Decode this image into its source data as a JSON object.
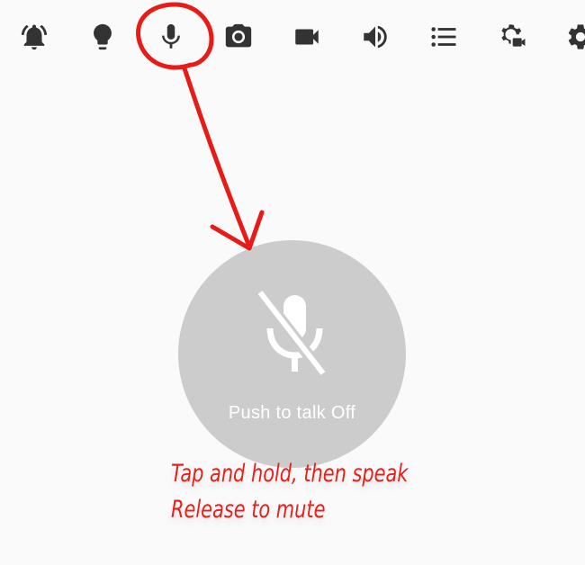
{
  "toolbar": {
    "items": [
      {
        "icon": "alarm-bell-icon",
        "label": "Alarm"
      },
      {
        "icon": "lightbulb-icon",
        "label": "Light"
      },
      {
        "icon": "microphone-icon",
        "label": "Push to talk"
      },
      {
        "icon": "camera-icon",
        "label": "Snapshot"
      },
      {
        "icon": "video-camera-icon",
        "label": "Video"
      },
      {
        "icon": "volume-icon",
        "label": "Volume"
      },
      {
        "icon": "list-icon",
        "label": "List"
      },
      {
        "icon": "camera-settings-icon",
        "label": "Camera settings"
      },
      {
        "icon": "settings-gear-icon",
        "label": "Settings"
      }
    ],
    "selected": "microphone-icon"
  },
  "push_to_talk": {
    "label": "Push to talk Off",
    "state_icon": "microphone-muted-icon"
  },
  "annotation": {
    "line1": "Tap and hold, then speak",
    "line2": "Release to mute"
  },
  "colors": {
    "icon": "#333333",
    "background": "#fafafa",
    "ptt_button": "#cccccc",
    "ptt_label": "#ffffff",
    "annotation": "#e8201a"
  }
}
